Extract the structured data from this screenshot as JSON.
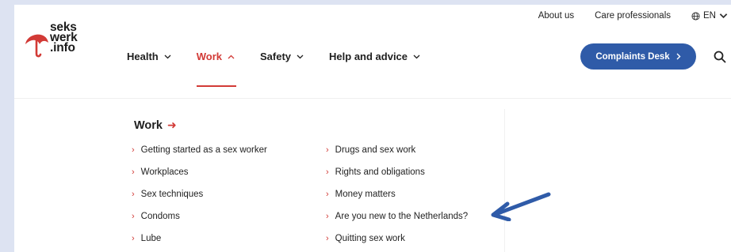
{
  "utility": {
    "about": "About us",
    "care": "Care professionals",
    "lang": "EN"
  },
  "logo": {
    "line1": "seks",
    "line2": "werk",
    "line3": ".info"
  },
  "nav": {
    "health": "Health",
    "work": "Work",
    "safety": "Safety",
    "help": "Help and advice"
  },
  "complaints_label": "Complaints Desk",
  "menu": {
    "title": "Work",
    "left": [
      "Getting started as a sex worker",
      "Workplaces",
      "Sex techniques",
      "Condoms",
      "Lube"
    ],
    "right": [
      "Drugs and sex work",
      "Rights and obligations",
      "Money matters",
      "Are you new to the Netherlands?",
      "Quitting sex work"
    ]
  },
  "colors": {
    "accent_red": "#d23a36",
    "button_blue": "#2f5ba8",
    "annotation_arrow": "#2f5ba8"
  }
}
